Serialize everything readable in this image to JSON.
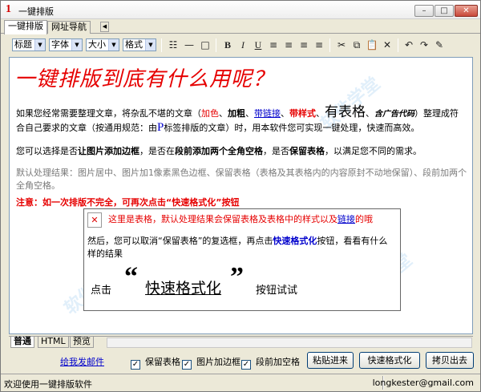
{
  "window": {
    "title": "一键排版",
    "app_icon": "1",
    "minimize_icon": "minimize-icon",
    "maximize_icon": "maximize-icon",
    "close_icon": "close-icon"
  },
  "top_tabs": [
    {
      "label": "一键排版"
    },
    {
      "label": "网址导航"
    }
  ],
  "toolbar": {
    "selects": [
      {
        "label": "标题"
      },
      {
        "label": "字体"
      },
      {
        "label": "大小"
      },
      {
        "label": "格式"
      }
    ],
    "bold": "B",
    "italic": "I",
    "underline": "U"
  },
  "editor": {
    "heading": "一键排版到底有什么用呢？",
    "p1_a": "如果您经常需要整理文章，将杂乱不堪的文章（",
    "p1_red": "加色",
    "p1_sep1": "、",
    "p1_bold": "加粗",
    "p1_sep2": "、",
    "p1_link": "带链接",
    "p1_sep3": "、",
    "p1_style": "带样式",
    "p1_sep4": "、",
    "p1_table": "有表格",
    "p1_sep5": "、",
    "p1_code": "含广告代码",
    "p1_b": "）整理成符合自己要求的文章（按通用规范：由",
    "p1_p": "P",
    "p1_c": "标签排版的文章）时，用本软件您可实现一键处理，快速而高效。",
    "p2_a": "您可以选择是否",
    "p2_b1": "让图片添加边框",
    "p2_b": "，是否在",
    "p2_b2": "段前添加两个全角空格",
    "p2_c": "，是否",
    "p2_b3": "保留表格",
    "p2_d": "，以满足您不同的需求。",
    "default_text": "默认处理结果：图片居中、图片加1像素黑色边框、保留表格（表格及其表格内的内容原封不动地保留）、段前加两个全角空格。",
    "note": "注意：如一次排版不完全，可再次点击“快速格式化”按钮",
    "table_line1_a": "这里是表格，默认处理结果会保留表格及表格中的样式以及",
    "table_line1_link": "链接",
    "table_line1_b": "的哦",
    "table_line2_a": "然后，您可以取消“保留表格”的复选框，再点击",
    "table_line2_bold": "快速格式化",
    "table_line2_b": "按钮，看看有什么样的结果",
    "click_prefix": "点击",
    "quote_open": "“",
    "quick_format": "快速格式化",
    "quote_close": "”",
    "click_suffix": "按钮试试"
  },
  "bottom_tabs": [
    {
      "label": "普通"
    },
    {
      "label": "HTML"
    },
    {
      "label": "预览"
    }
  ],
  "bottom": {
    "mail_link": "给我发邮件",
    "checkboxes": [
      {
        "label": "保留表格",
        "checked": true
      },
      {
        "label": "图片加边框",
        "checked": true
      },
      {
        "label": "段前加空格",
        "checked": true
      }
    ],
    "paste_button": "粘贴进来",
    "format_button": "快速格式化",
    "copy_button": "拷贝出去"
  },
  "status": {
    "left": "欢迎使用一键排版软件",
    "email": "longkester@gmail.com"
  }
}
